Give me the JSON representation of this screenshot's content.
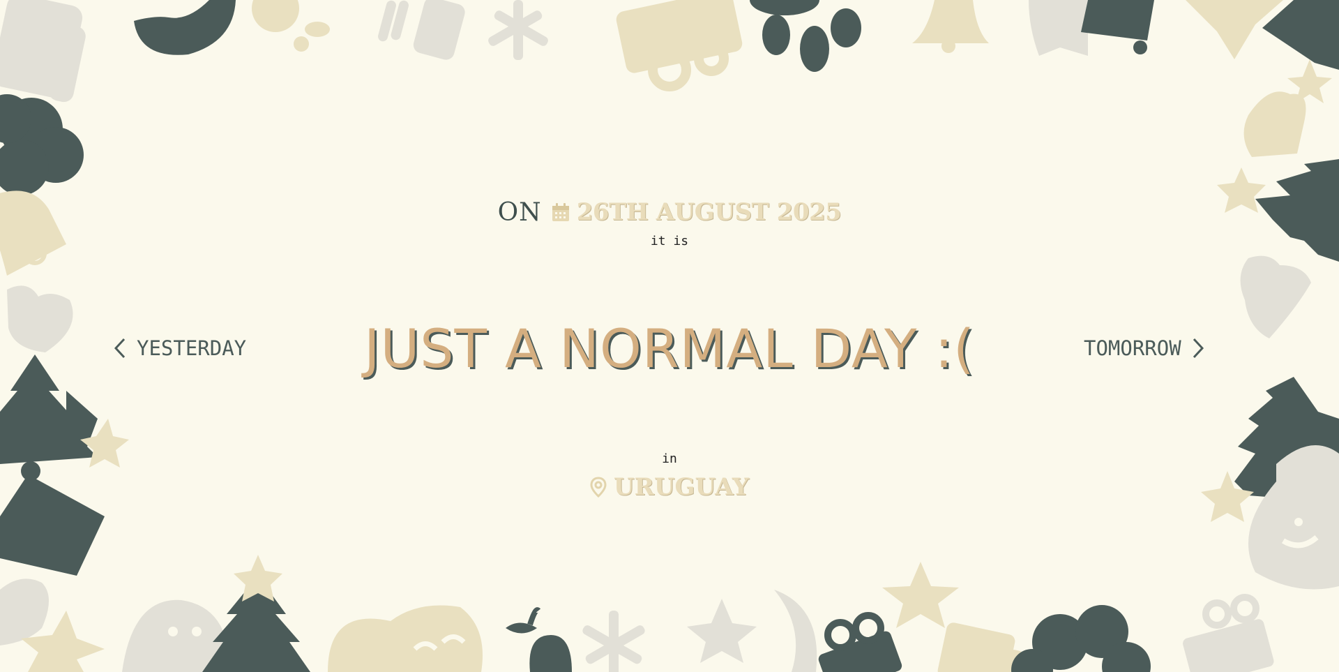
{
  "date_line": {
    "prefix": "ON",
    "date": "26TH AUGUST 2025"
  },
  "it_is_label": "it is",
  "headline": "JUST A NORMAL DAY :(",
  "in_label": "in",
  "location": "URUGUAY",
  "nav": {
    "previous_label": "YESTERDAY",
    "next_label": "TOMORROW"
  },
  "icons": {
    "date": "calendar-icon",
    "location": "map-pin-icon",
    "previous": "chevron-left-icon",
    "next": "chevron-right-icon"
  },
  "colors": {
    "background": "#fbf9ec",
    "headline": "#d4ae80",
    "headline_shadow": "#4b5b59",
    "accent_light": "#e9dcba",
    "dark": "#4b5b59"
  }
}
